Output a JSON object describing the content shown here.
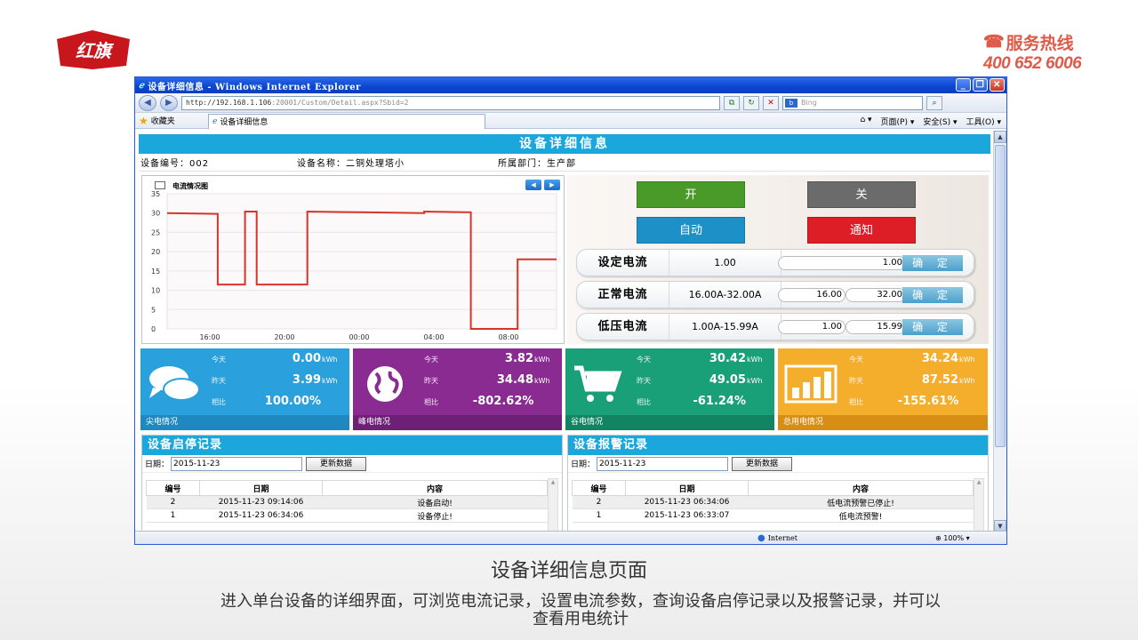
{
  "brand": {
    "logo_text": "红旗",
    "hotline_label": "服务热线",
    "hotline_number": "400 652 6006",
    "accent": "#e05a4a"
  },
  "browser": {
    "window_title": "设备详细信息 - Windows Internet Explorer",
    "address_host": "http://192.168.1.106",
    "address_rest": ":20001/Custom/Detail.aspx?Sbid=2",
    "search_placeholder": "Bing",
    "favorites_label": "收藏夹",
    "tab_title": "设备详细信息",
    "tools": [
      "页面(P) ▾",
      "安全(S) ▾",
      "工具(O) ▾"
    ],
    "status_zone": "Internet",
    "zoom": "100%"
  },
  "page": {
    "title": "设备详细信息",
    "device_no": "设备编号：002",
    "device_name": "设备名称：二铜处理塔小",
    "department": "所属部门：生产部"
  },
  "chart_data": {
    "type": "line",
    "title": "电流情况图",
    "ylim": [
      0,
      35
    ],
    "yticks": [
      "35",
      "30",
      "25",
      "20",
      "15",
      "10",
      "5",
      "0"
    ],
    "xticks": [
      "16:00",
      "20:00",
      "00:00",
      "04:00",
      "08:00"
    ],
    "color": "#d9342a",
    "points": [
      [
        0,
        30
      ],
      [
        0.13,
        29.8
      ],
      [
        0.13,
        11.5
      ],
      [
        0.2,
        11.5
      ],
      [
        0.2,
        30.4
      ],
      [
        0.23,
        30.4
      ],
      [
        0.23,
        11.5
      ],
      [
        0.36,
        11.5
      ],
      [
        0.36,
        30.4
      ],
      [
        0.5,
        30.2
      ],
      [
        0.66,
        30
      ],
      [
        0.66,
        30.4
      ],
      [
        0.78,
        30.2
      ],
      [
        0.78,
        0
      ],
      [
        0.9,
        0
      ],
      [
        0.9,
        18
      ],
      [
        1,
        18
      ]
    ]
  },
  "controls": {
    "on_label": "开",
    "off_label": "关",
    "auto_label": "自动",
    "notify_label": "通知",
    "on_color": "#4a9a2a",
    "off_color": "#6b6b6b",
    "auto_color": "#1e90c8",
    "notify_color": "#dd1e26",
    "confirm_label": "确 定",
    "set_current": {
      "label": "设定电流",
      "range": "1.00",
      "value": "1.00"
    },
    "normal_current": {
      "label": "正常电流",
      "range": "16.00A-32.00A",
      "min": "16.00",
      "max": "32.00"
    },
    "low_current": {
      "label": "低压电流",
      "range": "1.00A-15.99A",
      "min": "1.00",
      "max": "15.99"
    }
  },
  "tiles": [
    {
      "name": "尖电情况",
      "color": "#2aa0dc",
      "foot": "#1f88c0",
      "icon": "chat-icon",
      "today": "0.00",
      "yesterday": "3.99",
      "ratio": "100.00%"
    },
    {
      "name": "峰电情况",
      "color": "#8a2b92",
      "foot": "#6e1f76",
      "icon": "globe-icon",
      "today": "3.82",
      "yesterday": "34.48",
      "ratio": "-802.62%"
    },
    {
      "name": "谷电情况",
      "color": "#1aa078",
      "foot": "#128462",
      "icon": "cart-icon",
      "today": "30.42",
      "yesterday": "49.05",
      "ratio": "-61.24%"
    },
    {
      "name": "总用电情况",
      "color": "#f5ad2c",
      "foot": "#d88e12",
      "icon": "bar-chart-icon",
      "today": "34.24",
      "yesterday": "87.52",
      "ratio": "-155.61%"
    }
  ],
  "tile_labels": {
    "today": "今天",
    "yesterday": "昨天",
    "ratio": "相比",
    "unit": "kWh"
  },
  "start_stop": {
    "title": "设备启停记录",
    "date_label": "日期：",
    "date": "2015-11-23",
    "refresh": "更新数据",
    "headers": [
      "编号",
      "日期",
      "内容"
    ],
    "rows": [
      [
        "2",
        "2015-11-23 09:14:06",
        "设备启动!"
      ],
      [
        "1",
        "2015-11-23 06:34:06",
        "设备停止!"
      ]
    ]
  },
  "alarm": {
    "title": "设备报警记录",
    "date_label": "日期：",
    "date": "2015-11-23",
    "refresh": "更新数据",
    "headers": [
      "编号",
      "日期",
      "内容"
    ],
    "rows": [
      [
        "2",
        "2015-11-23 06:34:06",
        "低电流预警已停止!"
      ],
      [
        "1",
        "2015-11-23 06:33:07",
        "低电流预警!"
      ]
    ]
  },
  "caption": "设备详细信息页面",
  "description": "进入单台设备的详细界面，可浏览电流记录，设置电流参数，查询设备启停记录以及报警记录，并可以查看用电统计"
}
